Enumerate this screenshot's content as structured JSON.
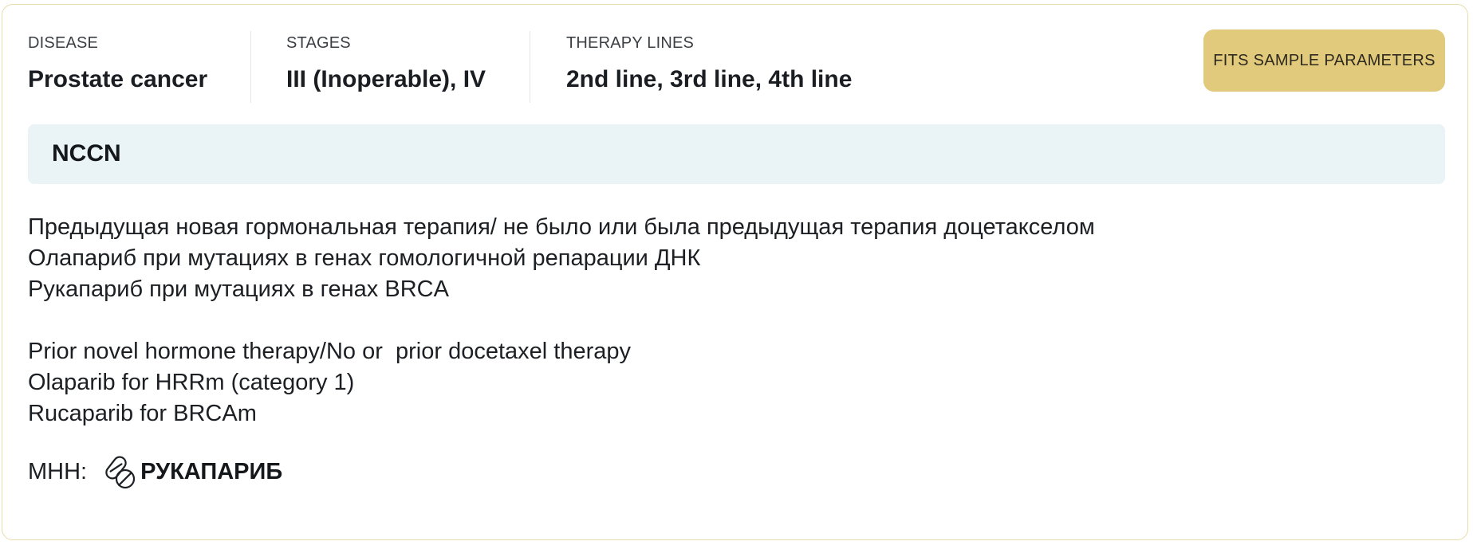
{
  "summary": {
    "disease": {
      "label": "DISEASE",
      "value": "Prostate cancer"
    },
    "stages": {
      "label": "STAGES",
      "value": "III (Inoperable), IV"
    },
    "therapy_lines": {
      "label": "THERAPY LINES",
      "value": "2nd line, 3rd line, 4th line"
    },
    "fit_badge": "FITS SAMPLE PARAMETERS"
  },
  "guideline": {
    "title": "NCCN",
    "description_ru": [
      "Предыдущая новая гормональная терапия/ не было или была предыдущая терапия доцетакселом",
      "Олапариб при мутациях в генах гомологичной репарации ДНК",
      "Рукапариб при мутациях в генах BRCA"
    ],
    "description_en": [
      "Prior novel hormone therapy/No or  prior docetaxel therapy",
      "Olaparib for HRRm (category 1)",
      "Rucaparib for BRCAm"
    ]
  },
  "mnn": {
    "label": "МНН:",
    "icon": "pill-icon",
    "drug": "РУКАПАРИБ"
  },
  "colors": {
    "badge_background": "#e1ca7b",
    "card_border": "#e8dcaa",
    "guideline_background": "#eaf3f6"
  }
}
